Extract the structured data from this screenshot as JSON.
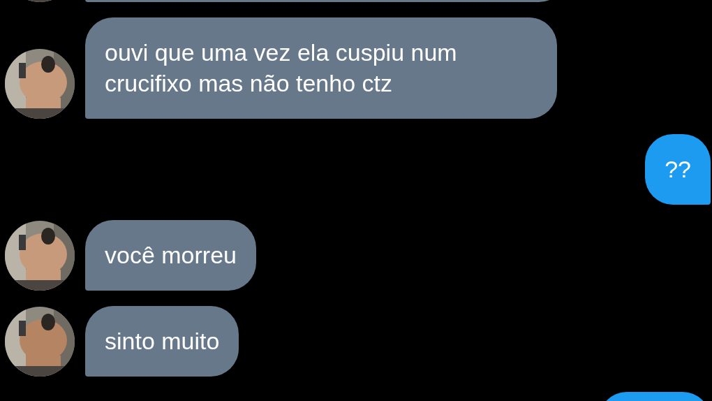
{
  "messages": [
    {
      "kind": "received"
    },
    {
      "kind": "received",
      "text": "ouvi que uma vez ela cuspiu num crucifixo mas não tenho ctz"
    },
    {
      "kind": "sent",
      "text": "??"
    },
    {
      "kind": "received",
      "text": "você morreu"
    },
    {
      "kind": "received",
      "text": "sinto muito"
    },
    {
      "kind": "sent"
    }
  ]
}
